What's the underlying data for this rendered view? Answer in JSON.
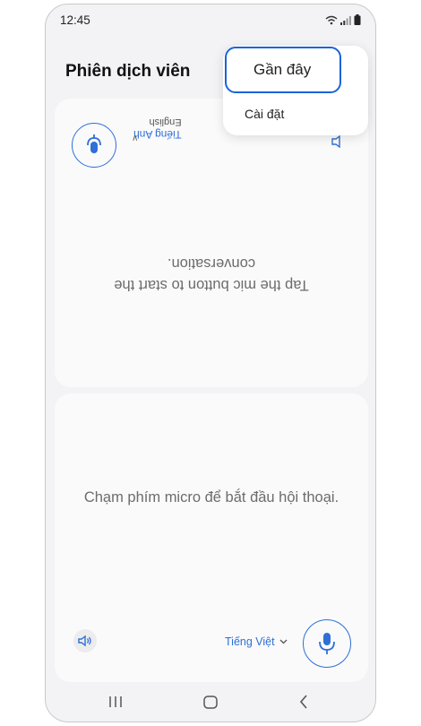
{
  "status": {
    "time": "12:45"
  },
  "header": {
    "title": "Phiên dịch viên"
  },
  "partner_panel": {
    "language": "Tiếng Anh",
    "sublanguage": "English",
    "hint": "Tap the mic button to start the conversation."
  },
  "my_panel": {
    "hint": "Chạm phím micro để bắt đầu hội thoại.",
    "language": "Tiếng Việt"
  },
  "menu": {
    "items": [
      {
        "label": "Gần đây"
      },
      {
        "label": "Cài đặt"
      }
    ]
  },
  "colors": {
    "accent": "#2f6fd6",
    "focus": "#1a63d8"
  }
}
